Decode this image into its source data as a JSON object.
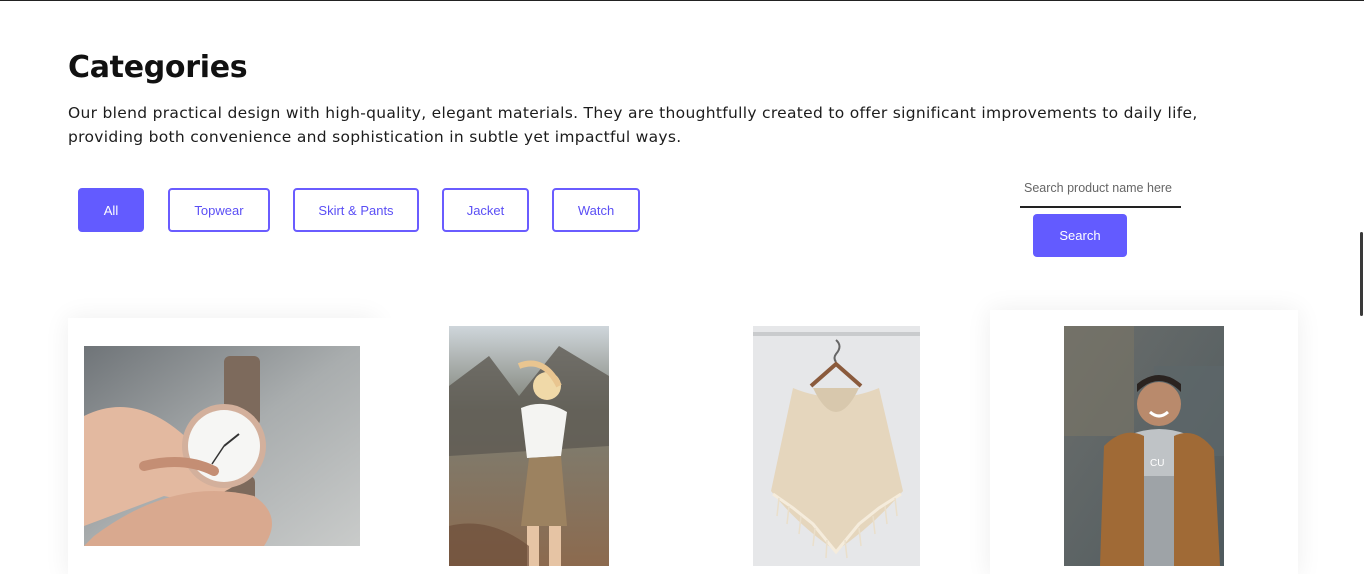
{
  "page": {
    "title": "Categories",
    "description": "Our blend practical design with high-quality, elegant materials. They are thoughtfully created to offer significant improvements to daily life, providing both convenience and sophistication in subtle yet impactful ways."
  },
  "filters": {
    "active": "All",
    "items": [
      {
        "label": "All"
      },
      {
        "label": "Topwear"
      },
      {
        "label": "Skirt & Pants"
      },
      {
        "label": "Jacket"
      },
      {
        "label": "Watch"
      }
    ]
  },
  "search": {
    "placeholder": "Search product name here",
    "value": "",
    "button_label": "Search"
  },
  "products": [
    {
      "image": "watch-in-hand-photo"
    },
    {
      "image": "woman-in-skirt-photo"
    },
    {
      "image": "knit-poncho-on-hanger-photo"
    },
    {
      "image": "man-in-jacket-photo"
    }
  ],
  "colors": {
    "accent": "#635bff",
    "accent_text": "#5b4ff5",
    "title": "#111111"
  }
}
